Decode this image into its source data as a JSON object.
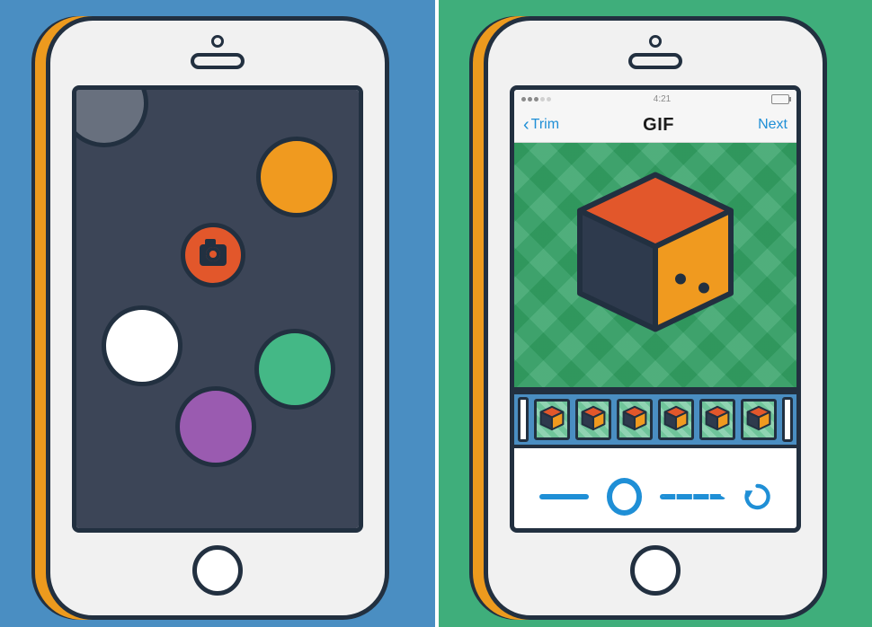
{
  "left": {
    "dots": [
      "grey",
      "orange",
      "white",
      "green",
      "purple"
    ],
    "camera_button": "camera-icon"
  },
  "right": {
    "status": {
      "time": "4:21"
    },
    "nav": {
      "back": "Trim",
      "title": "GIF",
      "next": "Next"
    },
    "slider": {
      "position": 0.35
    },
    "loop_mode": "repeat"
  }
}
